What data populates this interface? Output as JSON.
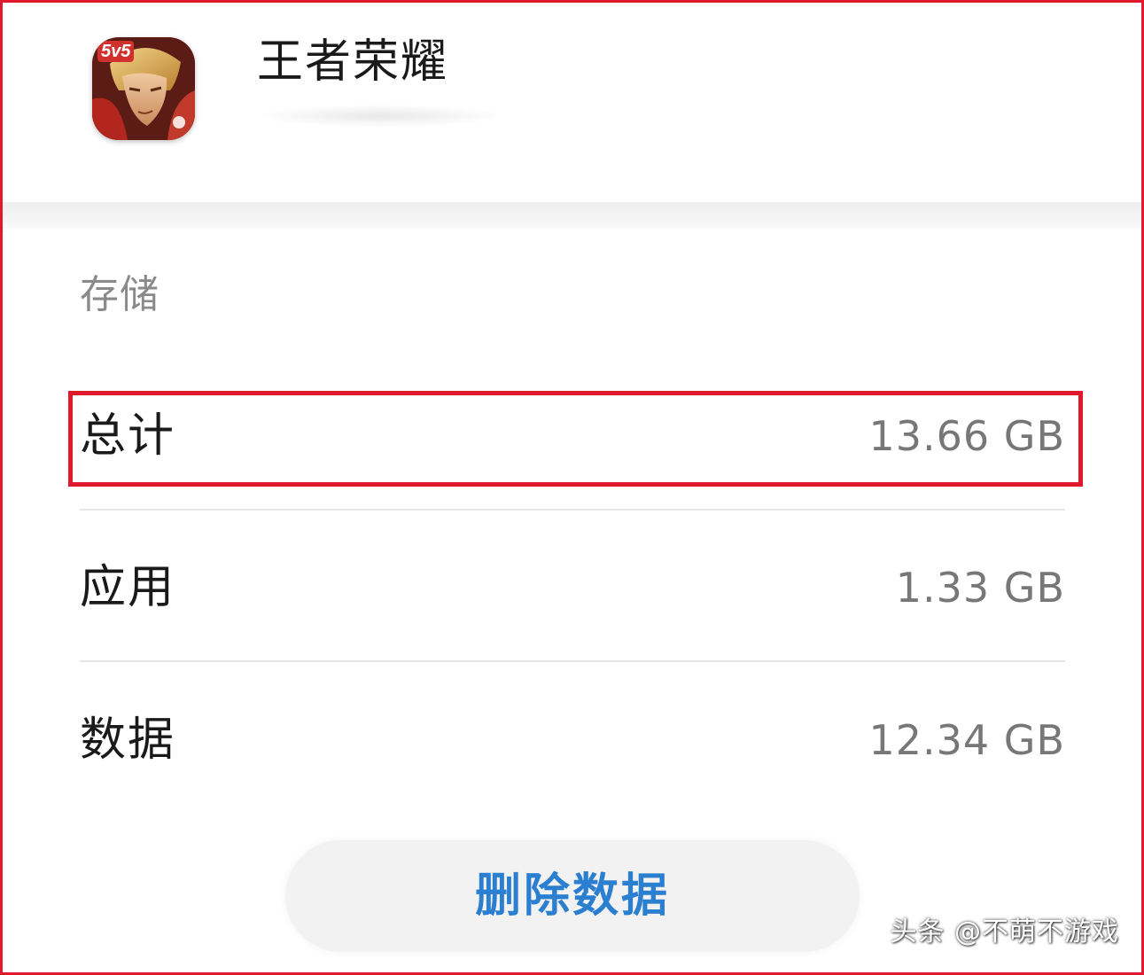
{
  "app": {
    "name": "王者荣耀",
    "icon": "honor-of-kings-app-icon",
    "icon_badge": "5v5"
  },
  "storage": {
    "section_label": "存储",
    "rows": [
      {
        "label": "总计",
        "value": "13.66 GB"
      },
      {
        "label": "应用",
        "value": "1.33 GB"
      },
      {
        "label": "数据",
        "value": "12.34 GB"
      }
    ]
  },
  "actions": {
    "delete_data_label": "删除数据"
  },
  "watermark": "头条 @不萌不游戏",
  "colors": {
    "highlight": "#e0192c",
    "accent": "#2b7fd0",
    "value_text": "#777777"
  }
}
